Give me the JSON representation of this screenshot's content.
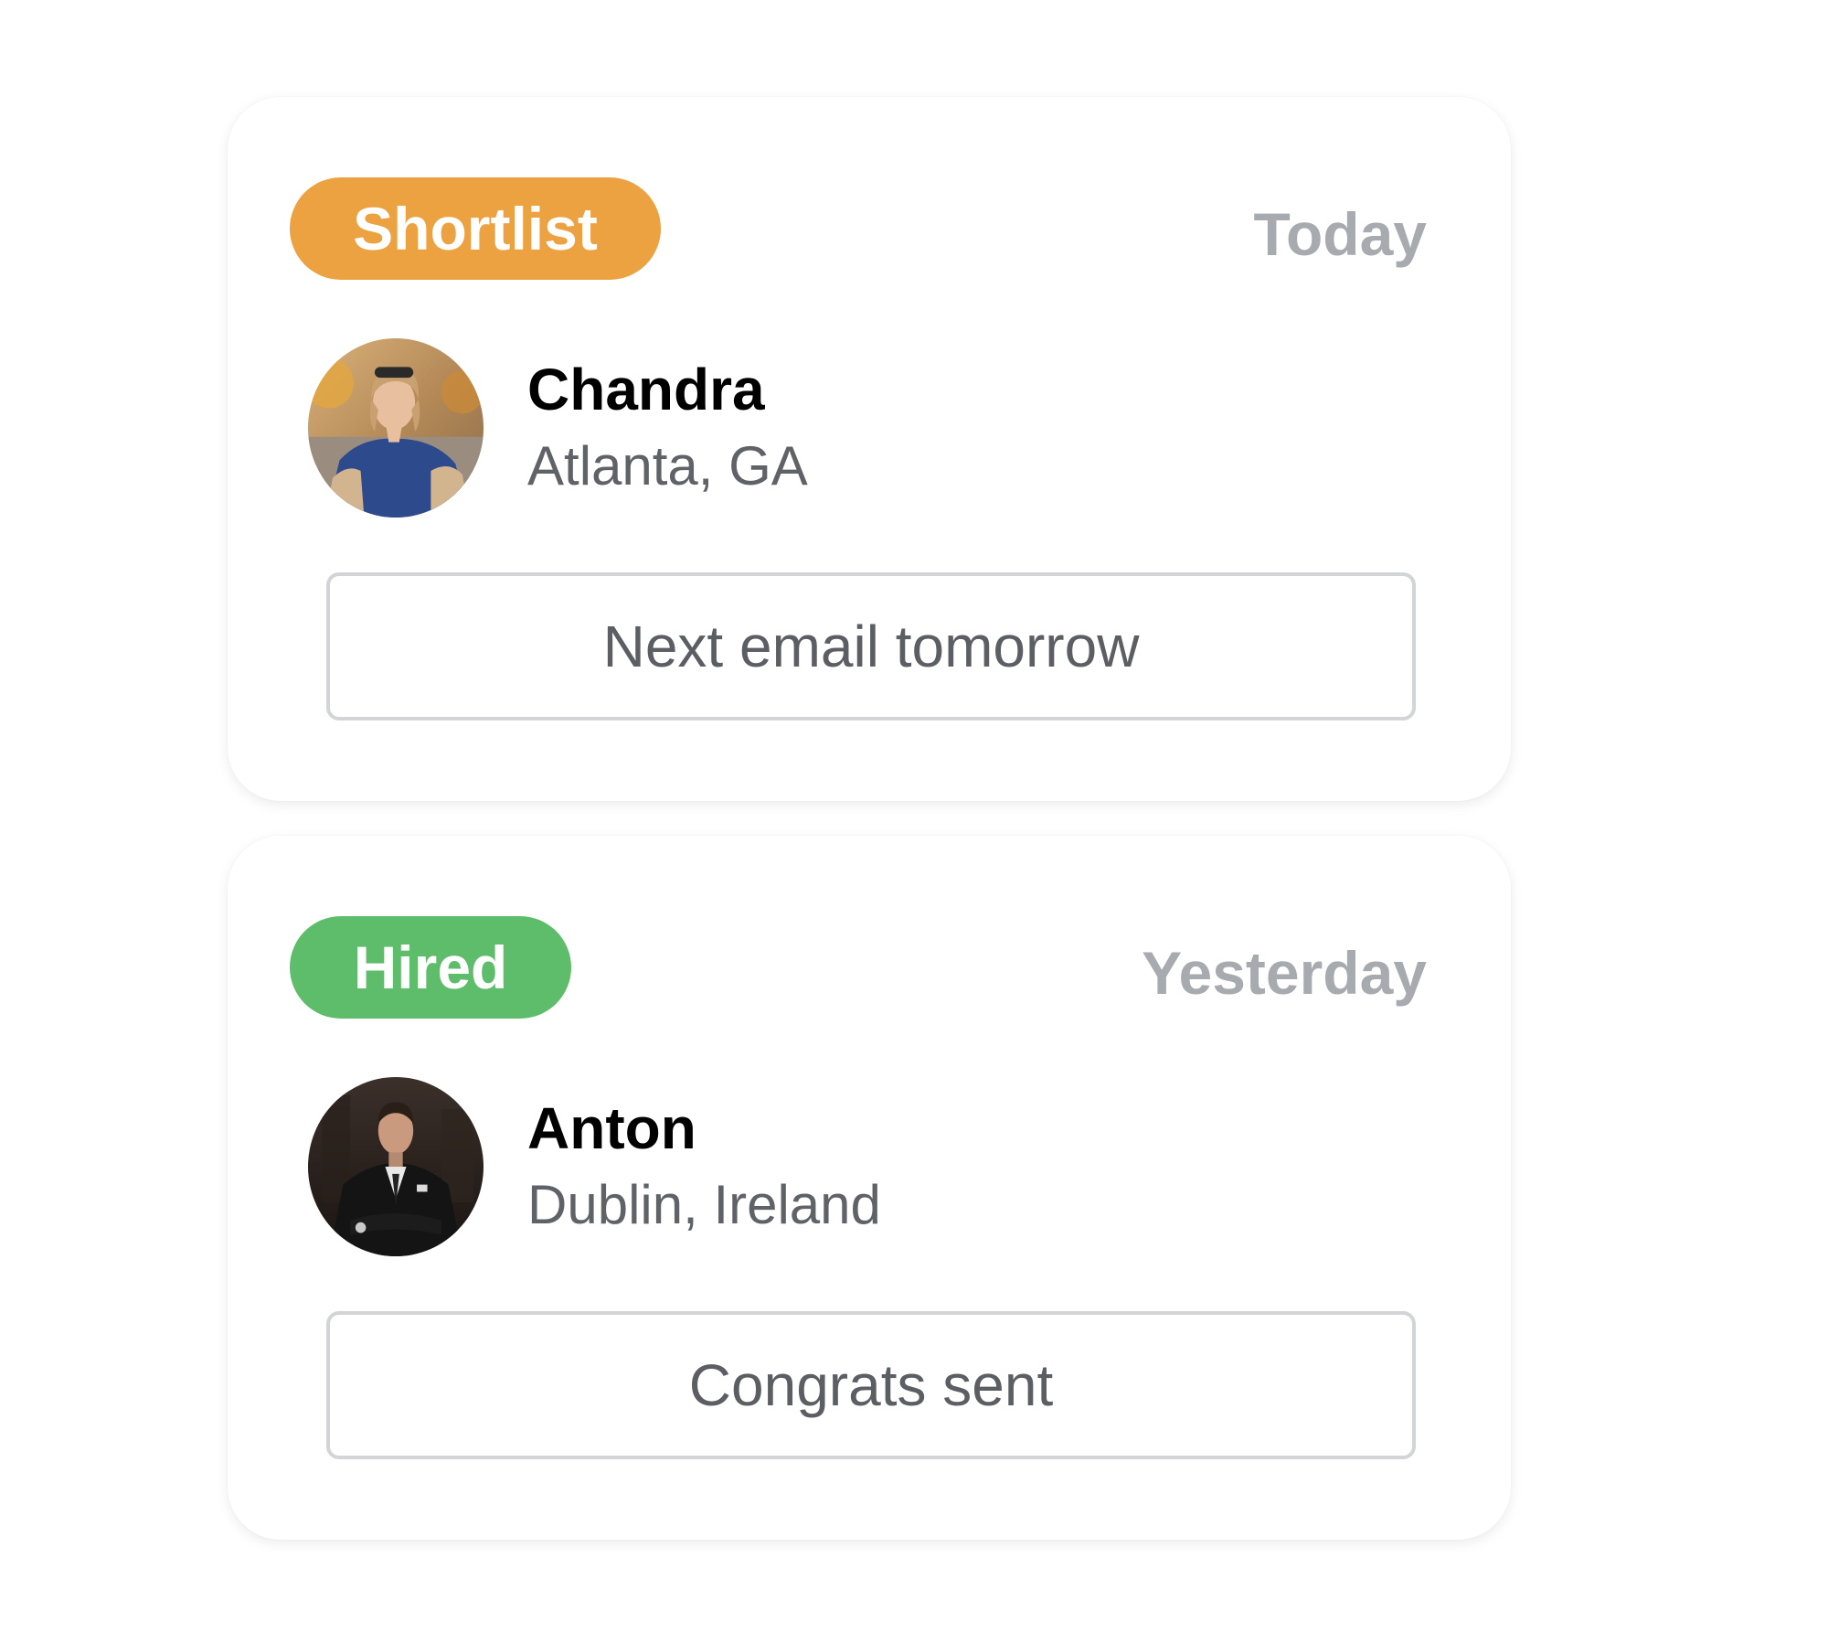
{
  "cards": [
    {
      "status": {
        "label": "Shortlist",
        "color": "#eda242"
      },
      "date": "Today",
      "person": {
        "name": "Chandra",
        "location": "Atlanta, GA",
        "avatar_icon": "avatar-photo-woman"
      },
      "action_label": "Next email tomorrow"
    },
    {
      "status": {
        "label": "Hired",
        "color": "#5ebd6a"
      },
      "date": "Yesterday",
      "person": {
        "name": "Anton",
        "location": "Dublin, Ireland",
        "avatar_icon": "avatar-photo-man"
      },
      "action_label": "Congrats sent"
    }
  ]
}
